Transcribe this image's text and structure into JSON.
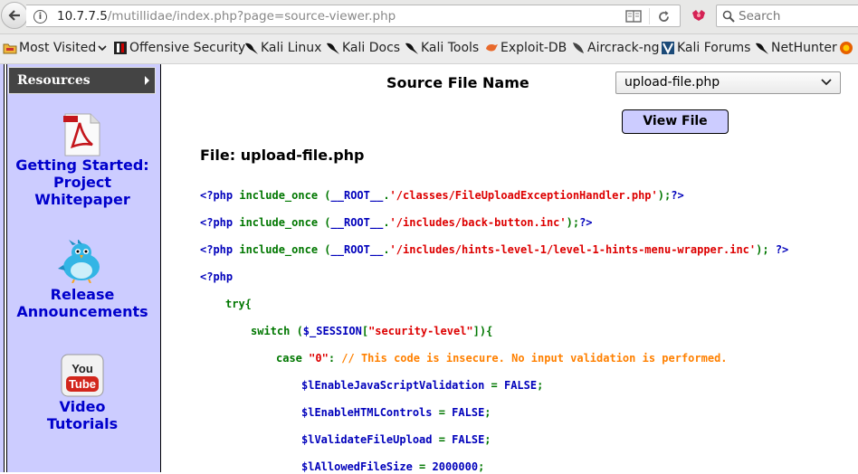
{
  "browser": {
    "url_host": "10.7.7.5",
    "url_path": "/mutillidae/index.php?page=source-viewer.php",
    "search_placeholder": "Search"
  },
  "bookmarks": [
    {
      "label": "Most Visited",
      "icon": "bookmark-folder-icon"
    },
    {
      "label": "Offensive Security",
      "icon": "offsec-icon"
    },
    {
      "label": "Kali Linux",
      "icon": "kali-dragon-icon"
    },
    {
      "label": "Kali Docs",
      "icon": "kali-dragon-icon"
    },
    {
      "label": "Kali Tools",
      "icon": "kali-dragon-icon"
    },
    {
      "label": "Exploit-DB",
      "icon": "exploitdb-icon"
    },
    {
      "label": "Aircrack-ng",
      "icon": "aircrack-icon"
    },
    {
      "label": "Kali Forums",
      "icon": "kali-forums-icon"
    },
    {
      "label": "NetHunter",
      "icon": "kali-dragon-icon"
    }
  ],
  "sidebar": {
    "resources_label": "Resources",
    "links": [
      {
        "lines": [
          "Getting Started:",
          "Project",
          "Whitepaper"
        ],
        "icon": "pdf-icon"
      },
      {
        "lines": [
          "Release",
          "Announcements"
        ],
        "icon": "twitter-bird-icon"
      },
      {
        "lines": [
          "Video",
          "Tutorials"
        ],
        "icon": "youtube-icon"
      }
    ]
  },
  "main": {
    "source_file_label": "Source File Name",
    "selected_file": "upload-file.php",
    "view_button": "View File",
    "file_heading": "File: upload-file.php"
  },
  "code_lines": [
    {
      "indent": 0,
      "tokens": [
        [
          "b",
          "<?php "
        ],
        [
          "g",
          "include_once ("
        ],
        [
          "b",
          "__ROOT__"
        ],
        [
          "g",
          "."
        ],
        [
          "r",
          "'/classes/FileUploadExceptionHandler.php'"
        ],
        [
          "g",
          ");"
        ],
        [
          "b",
          "?>"
        ]
      ]
    },
    {
      "indent": 0,
      "tokens": [
        [
          "b",
          "<?php "
        ],
        [
          "g",
          "include_once ("
        ],
        [
          "b",
          "__ROOT__"
        ],
        [
          "g",
          "."
        ],
        [
          "r",
          "'/includes/back-button.inc'"
        ],
        [
          "g",
          ");"
        ],
        [
          "b",
          "?>"
        ]
      ]
    },
    {
      "indent": 0,
      "tokens": [
        [
          "b",
          "<?php "
        ],
        [
          "g",
          "include_once ("
        ],
        [
          "b",
          "__ROOT__"
        ],
        [
          "g",
          "."
        ],
        [
          "r",
          "'/includes/hints-level-1/level-1-hints-menu-wrapper.inc'"
        ],
        [
          "g",
          "); "
        ],
        [
          "b",
          "?>"
        ]
      ]
    },
    {
      "indent": 0,
      "tokens": [
        [
          "b",
          "<?php"
        ]
      ]
    },
    {
      "indent": 1,
      "tokens": [
        [
          "g",
          "try{"
        ]
      ]
    },
    {
      "indent": 2,
      "tokens": [
        [
          "g",
          "switch ("
        ],
        [
          "b",
          "$_SESSION"
        ],
        [
          "g",
          "["
        ],
        [
          "r",
          "\"security-level\""
        ],
        [
          "g",
          "]){"
        ]
      ]
    },
    {
      "indent": 3,
      "tokens": [
        [
          "g",
          "case "
        ],
        [
          "r",
          "\"0\""
        ],
        [
          "g",
          ": "
        ],
        [
          "o",
          "// This code is insecure. No input validation is performed."
        ]
      ]
    },
    {
      "indent": 4,
      "tokens": [
        [
          "b",
          "$lEnableJavaScriptValidation "
        ],
        [
          "g",
          "= "
        ],
        [
          "b",
          "FALSE"
        ],
        [
          "g",
          ";"
        ]
      ]
    },
    {
      "indent": 4,
      "tokens": [
        [
          "b",
          "$lEnableHTMLControls "
        ],
        [
          "g",
          "= "
        ],
        [
          "b",
          "FALSE"
        ],
        [
          "g",
          ";"
        ]
      ]
    },
    {
      "indent": 4,
      "tokens": [
        [
          "b",
          "$lValidateFileUpload "
        ],
        [
          "g",
          "= "
        ],
        [
          "b",
          "FALSE"
        ],
        [
          "g",
          ";"
        ]
      ]
    },
    {
      "indent": 4,
      "tokens": [
        [
          "b",
          "$lAllowedFileSize "
        ],
        [
          "g",
          "= "
        ],
        [
          "b",
          "2000000"
        ],
        [
          "g",
          ";"
        ]
      ]
    }
  ]
}
